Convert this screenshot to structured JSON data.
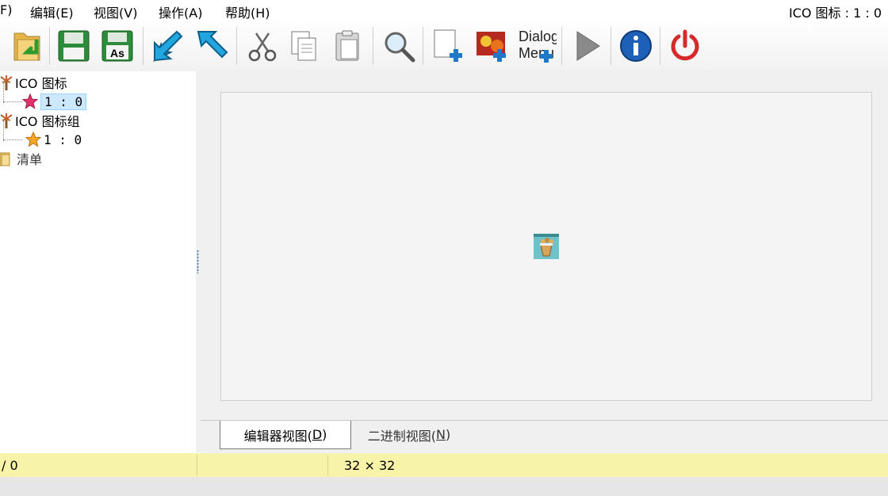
{
  "menu": {
    "items": [
      {
        "label": "F)"
      },
      {
        "label": "编辑(E)"
      },
      {
        "label": "视图(V)"
      },
      {
        "label": "操作(A)"
      },
      {
        "label": "帮助(H)"
      }
    ],
    "title_right": "ICO 图标 : 1 : 0"
  },
  "toolbar": {
    "buttons": [
      {
        "icon": "open-folder-icon"
      },
      {
        "icon": "save-icon"
      },
      {
        "icon": "save-as-icon",
        "label": "As"
      },
      {
        "icon": "import-arrow-icon"
      },
      {
        "icon": "export-arrow-icon"
      },
      {
        "icon": "cut-icon"
      },
      {
        "icon": "copy-icon"
      },
      {
        "icon": "paste-icon"
      },
      {
        "icon": "search-icon"
      },
      {
        "icon": "add-new-icon"
      },
      {
        "icon": "add-image-icon"
      },
      {
        "icon": "add-dialog-menu-icon",
        "label_line1": "Dialog",
        "label_line2": "Menu"
      },
      {
        "icon": "play-icon"
      },
      {
        "icon": "info-icon"
      },
      {
        "icon": "power-icon"
      }
    ]
  },
  "tree": {
    "nodes": [
      {
        "label": "ICO 图标",
        "icon": "palm-tree-icon"
      },
      {
        "label": "1 : 0",
        "icon": "star-pink-icon",
        "selected": true
      },
      {
        "label": "ICO 图标组",
        "icon": "palm-tree-icon"
      },
      {
        "label": "1 : 0",
        "icon": "star-orange-icon"
      },
      {
        "label": "清单",
        "icon": "folder-icon"
      }
    ]
  },
  "tabs": [
    {
      "label": "编辑器视图(",
      "key": "D",
      "suffix": ")",
      "active": true
    },
    {
      "label": "二进制视图(",
      "key": "N",
      "suffix": ")",
      "active": false
    }
  ],
  "status": {
    "cell1": "/ 0",
    "cell2": "",
    "cell3": "32 × 32"
  },
  "colors": {
    "status_bg": "#f7f3a8",
    "selection_bg": "#cce8ff"
  }
}
